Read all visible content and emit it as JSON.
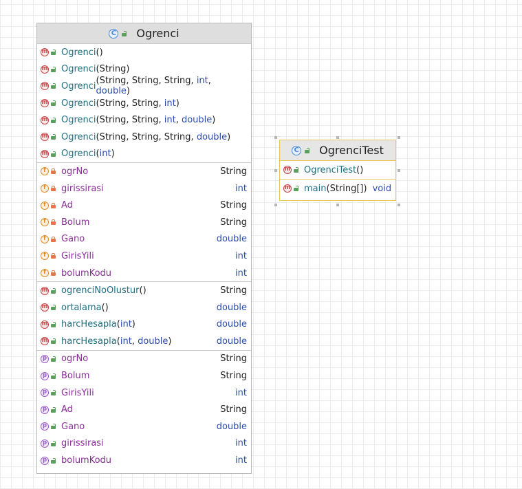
{
  "classes": {
    "ogrenci": {
      "name": "Ogrenci",
      "constructors": [
        {
          "name": "Ogrenci",
          "params": []
        },
        {
          "name": "Ogrenci",
          "params": [
            "String"
          ]
        },
        {
          "name": "Ogrenci",
          "params": [
            "String",
            "String",
            "String",
            "int",
            "double"
          ]
        },
        {
          "name": "Ogrenci",
          "params": [
            "String",
            "String",
            "int"
          ]
        },
        {
          "name": "Ogrenci",
          "params": [
            "String",
            "String",
            "int",
            "double"
          ]
        },
        {
          "name": "Ogrenci",
          "params": [
            "String",
            "String",
            "String",
            "double"
          ]
        },
        {
          "name": "Ogrenci",
          "params": [
            "int"
          ]
        }
      ],
      "fields": [
        {
          "name": "ogrNo",
          "type": "String"
        },
        {
          "name": "girissirasi",
          "type": "int"
        },
        {
          "name": "Ad",
          "type": "String"
        },
        {
          "name": "Bolum",
          "type": "String"
        },
        {
          "name": "Gano",
          "type": "double"
        },
        {
          "name": "GirisYili",
          "type": "int"
        },
        {
          "name": "bolumKodu",
          "type": "int"
        }
      ],
      "methods": [
        {
          "name": "ogrenciNoOlustur",
          "params": [],
          "type": "String"
        },
        {
          "name": "ortalama",
          "params": [],
          "type": "double"
        },
        {
          "name": "harcHesapla",
          "params": [
            "int"
          ],
          "type": "double"
        },
        {
          "name": "harcHesapla",
          "params": [
            "int",
            "double"
          ],
          "type": "double"
        }
      ],
      "properties": [
        {
          "name": "ogrNo",
          "type": "String"
        },
        {
          "name": "Bolum",
          "type": "String"
        },
        {
          "name": "GirisYili",
          "type": "int"
        },
        {
          "name": "Ad",
          "type": "String"
        },
        {
          "name": "Gano",
          "type": "double"
        },
        {
          "name": "girissirasi",
          "type": "int"
        },
        {
          "name": "bolumKodu",
          "type": "int"
        }
      ]
    },
    "ogrencitest": {
      "name": "OgrenciTest",
      "constructors": [
        {
          "name": "OgrenciTest",
          "params": []
        }
      ],
      "methods": [
        {
          "name": "main",
          "params": [
            "String[]"
          ],
          "type": "void"
        }
      ]
    }
  },
  "icons": {
    "class": "C",
    "method": "m",
    "field": "f",
    "property": "p"
  },
  "colors": {
    "selection_border": "#e8c558",
    "method_icon": "#c54444",
    "field_icon": "#e08a2b",
    "property_icon": "#9a5ac9",
    "class_icon": "#4a86d9"
  }
}
